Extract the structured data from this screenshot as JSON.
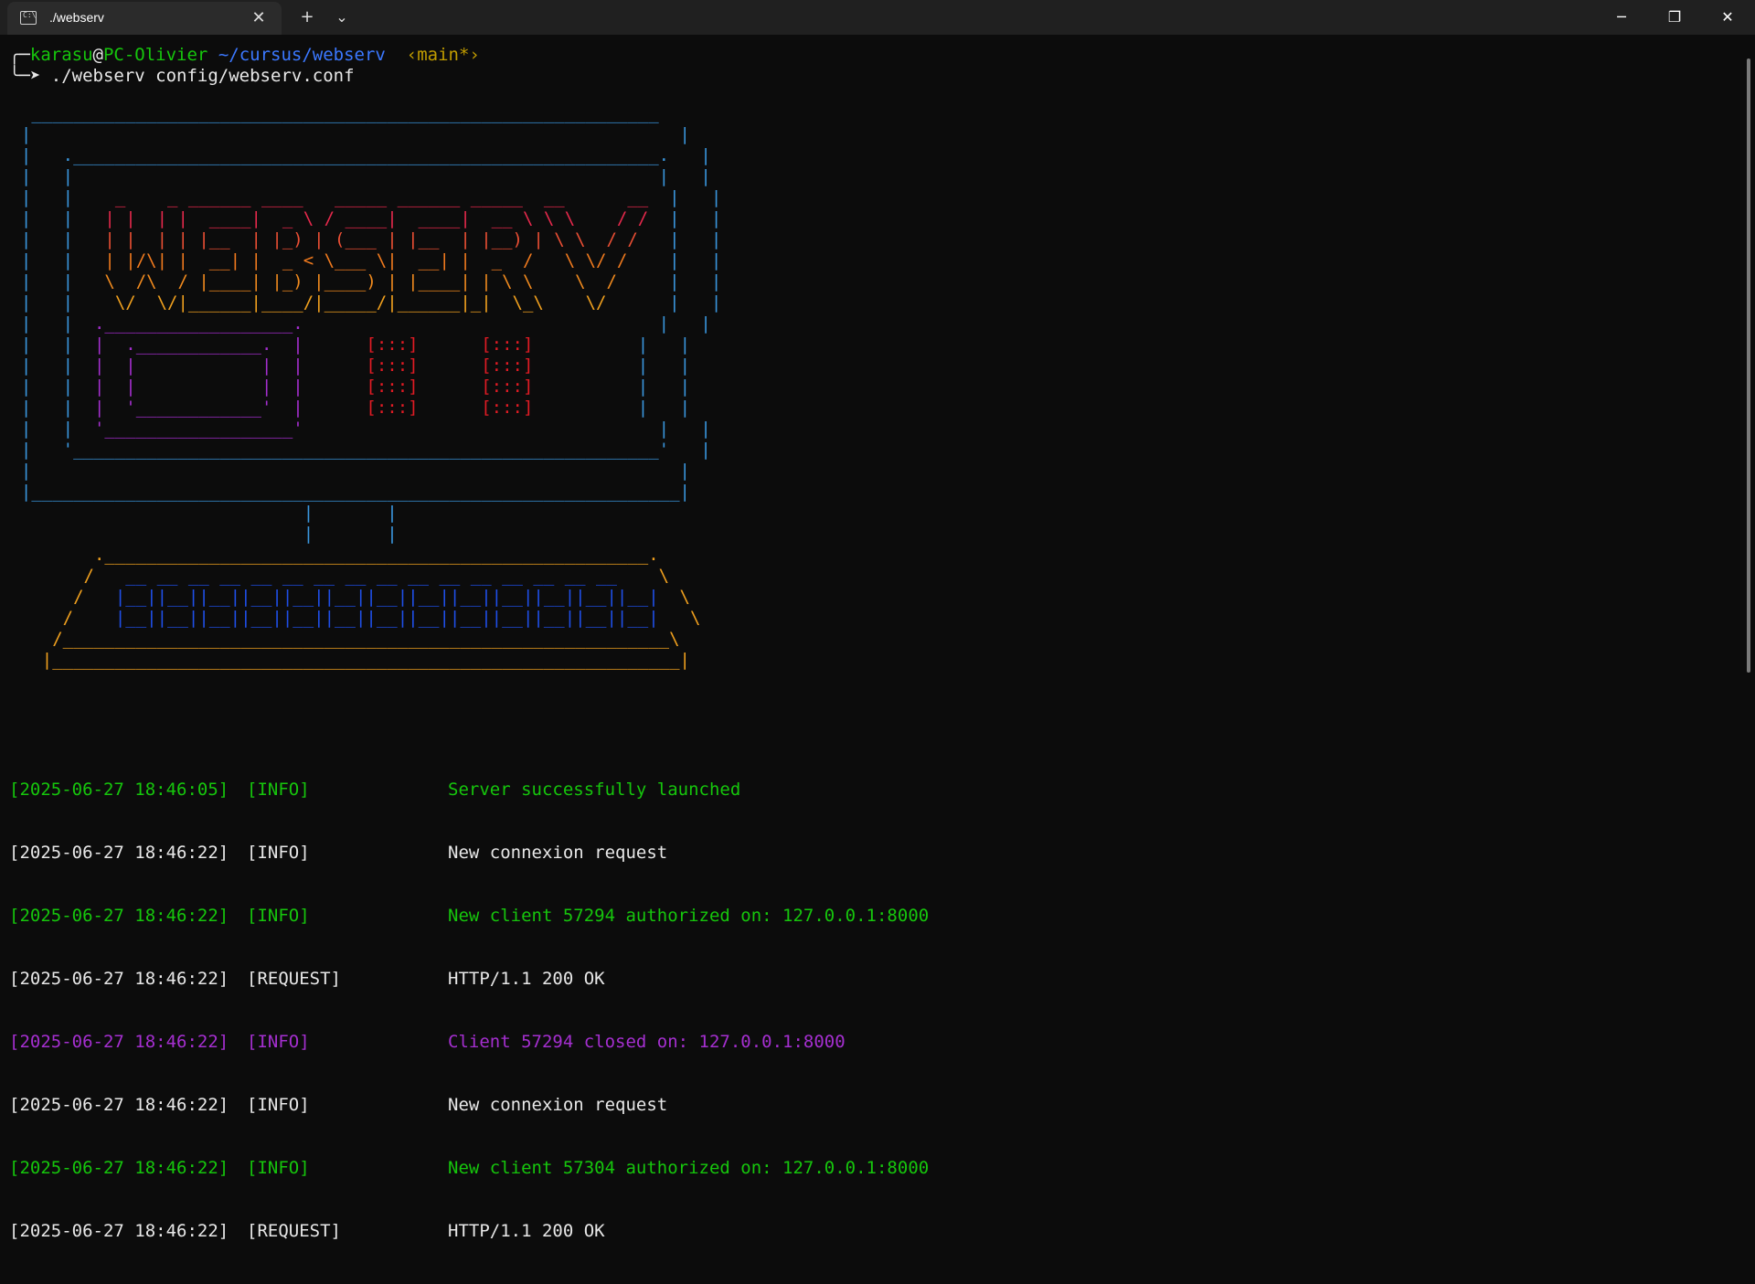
{
  "window": {
    "tab_title": "./webserv",
    "tab_icon": "terminal-icon",
    "new_tab": "+",
    "dropdown": "⌄",
    "close_tab": "✕",
    "minimize": "─",
    "maximize": "❐",
    "close": "✕"
  },
  "prompt": {
    "bracket_top": "╭─",
    "user": "karasu",
    "at": "@",
    "host": "PC-Olivier",
    "path": "~/cursus/webserv",
    "branch": "‹main*›",
    "bracket_bottom": "╰─➤",
    "command": "./webserv config/webserv.conf"
  },
  "colors": {
    "blue": "#3a96dd",
    "dark_blue": "#1f4fe8",
    "red": "#e6294c",
    "orange": "#f07a1e",
    "amber": "#f0a01e",
    "purple": "#a52fd0",
    "bright_red": "#e01b24",
    "green": "#16c60c",
    "white": "#e8e8e8",
    "yellow": "#c19c00"
  },
  "logs": [
    {
      "time": "[2025-06-27 18:46:05]",
      "level": "[INFO]",
      "message": "Server successfully launched",
      "color": "#16c60c"
    },
    {
      "time": "[2025-06-27 18:46:22]",
      "level": "[INFO]",
      "message": "New connexion request",
      "color": "#e8e8e8"
    },
    {
      "time": "[2025-06-27 18:46:22]",
      "level": "[INFO]",
      "message": "New client 57294 authorized on: 127.0.0.1:8000",
      "color": "#16c60c"
    },
    {
      "time": "[2025-06-27 18:46:22]",
      "level": "[REQUEST]",
      "message": "HTTP/1.1 200 OK",
      "color": "#e8e8e8"
    },
    {
      "time": "[2025-06-27 18:46:22]",
      "level": "[INFO]",
      "message": "Client 57294 closed on: 127.0.0.1:8000",
      "color": "#a52fd0"
    },
    {
      "time": "[2025-06-27 18:46:22]",
      "level": "[INFO]",
      "message": "New connexion request",
      "color": "#e8e8e8"
    },
    {
      "time": "[2025-06-27 18:46:22]",
      "level": "[INFO]",
      "message": "New client 57304 authorized on: 127.0.0.1:8000",
      "color": "#16c60c"
    },
    {
      "time": "[2025-06-27 18:46:22]",
      "level": "[REQUEST]",
      "message": "HTTP/1.1 200 OK",
      "color": "#e8e8e8"
    }
  ]
}
